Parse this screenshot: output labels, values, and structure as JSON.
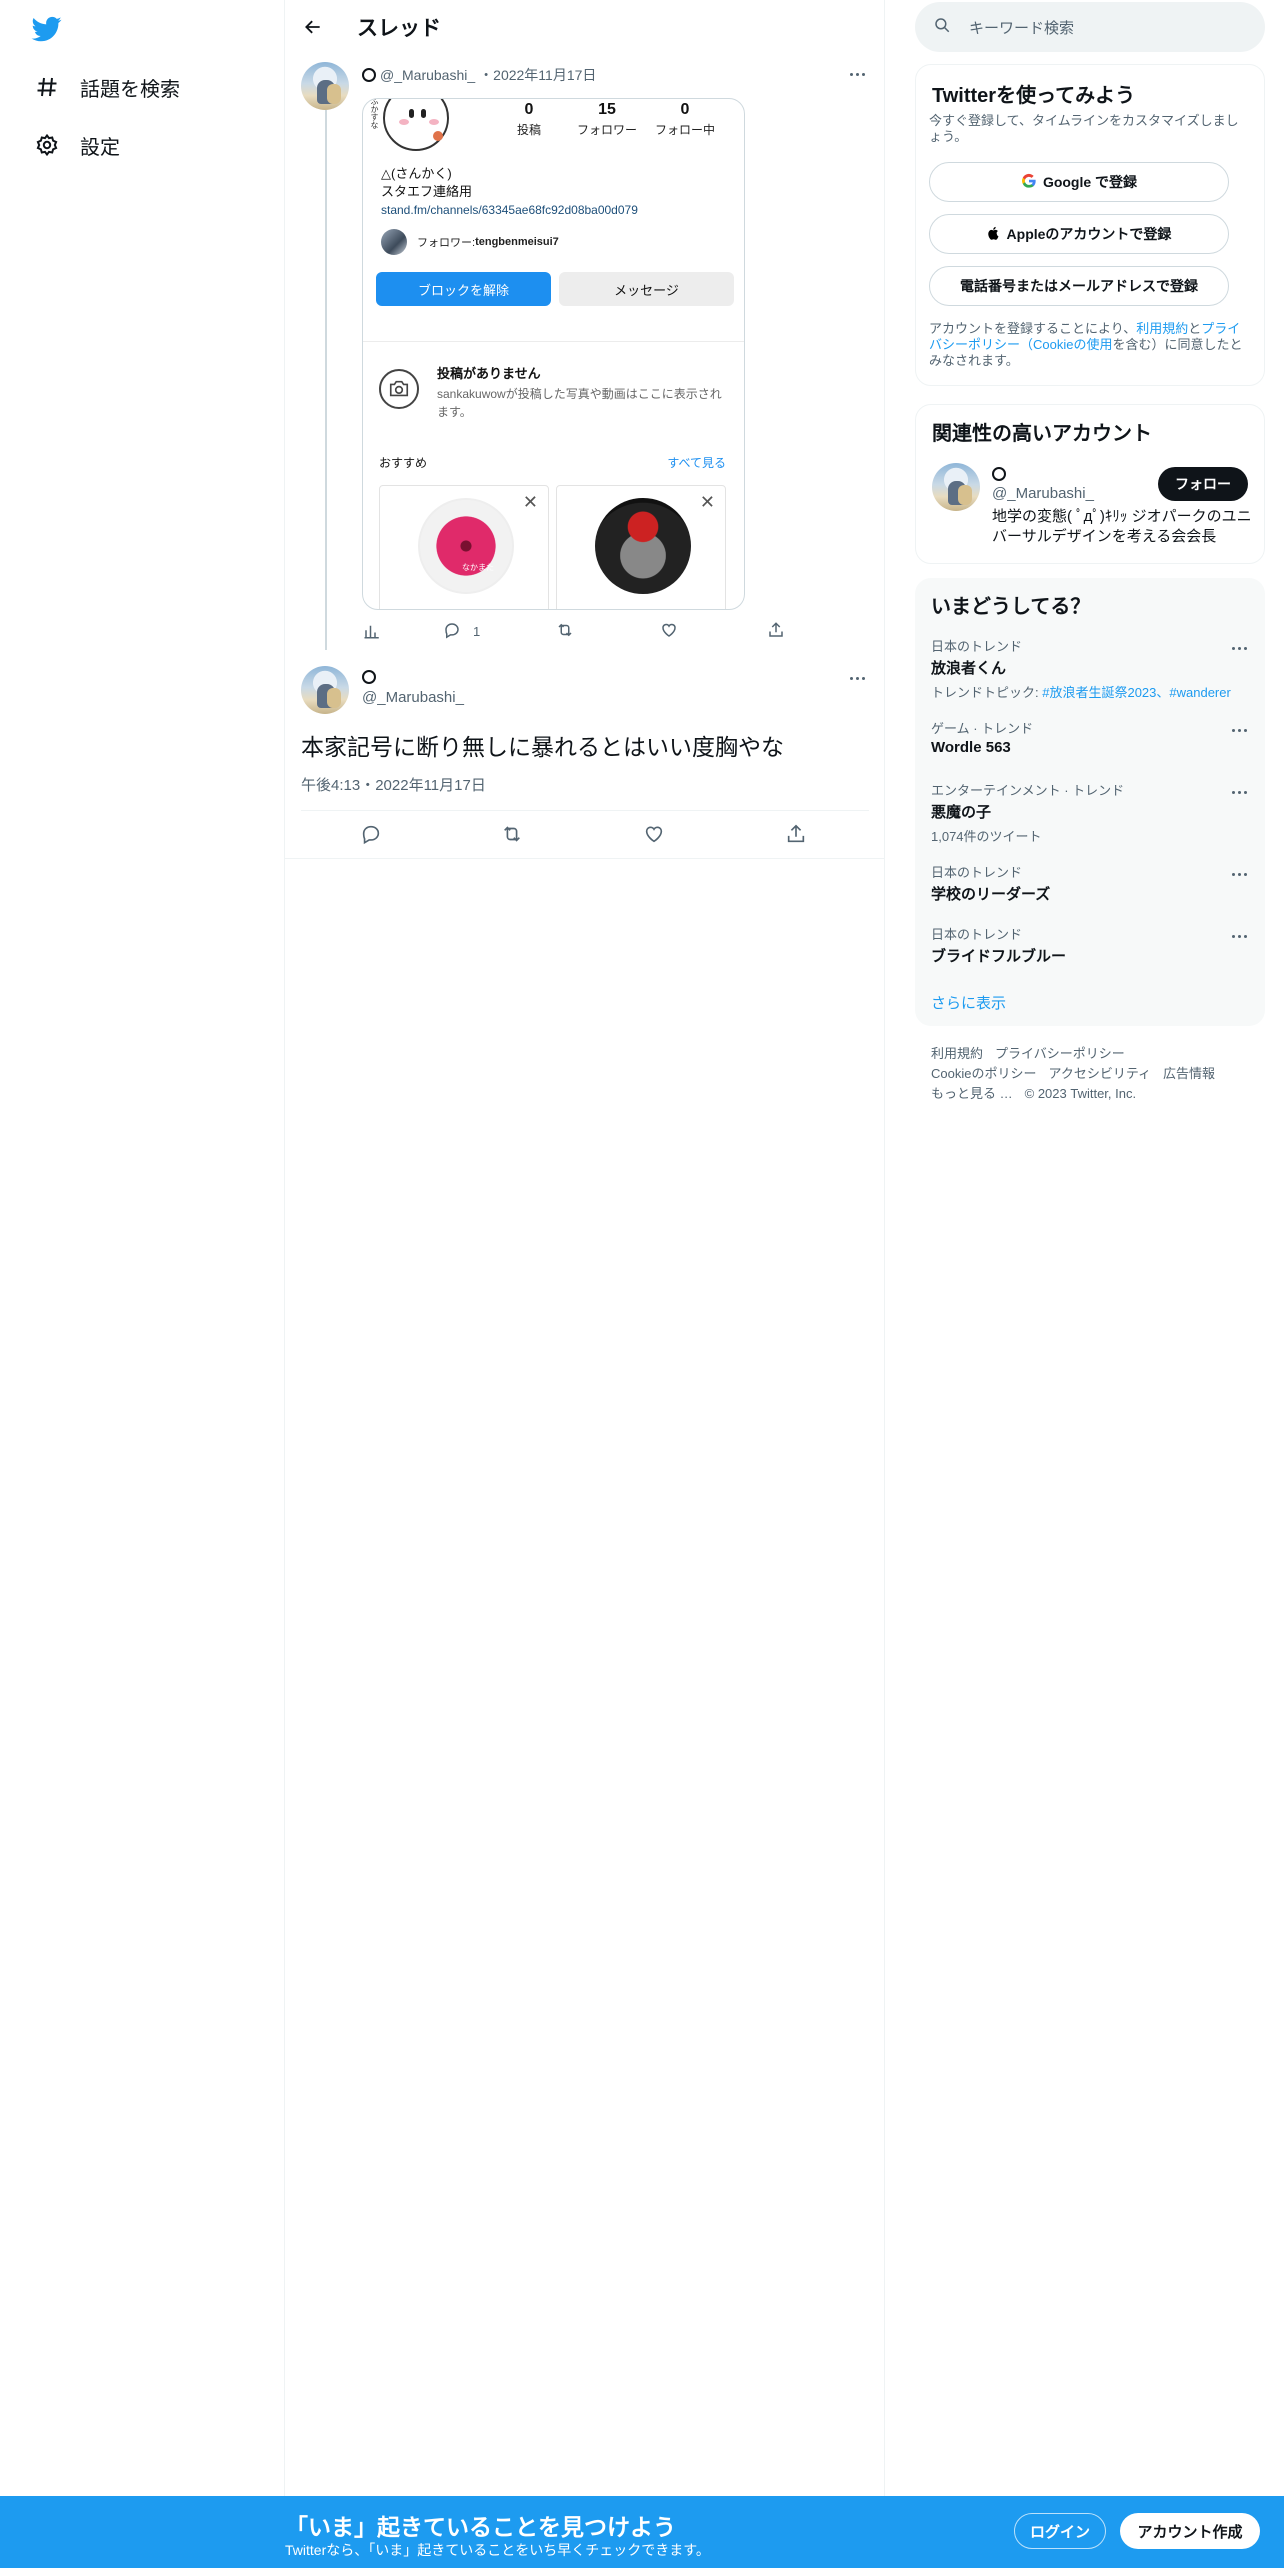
{
  "nav": {
    "items": [
      {
        "label": "話題を検索",
        "icon": "hashtag-icon"
      },
      {
        "label": "設定",
        "icon": "gear-icon"
      }
    ]
  },
  "header": {
    "title": "スレッド"
  },
  "first_tweet": {
    "handle": "@_Marubashi_",
    "date": "・2022年11月17日",
    "screenshot": {
      "stats": [
        {
          "num": "0",
          "label": "投稿"
        },
        {
          "num": "15",
          "label": "フォロワー"
        },
        {
          "num": "0",
          "label": "フォロー中"
        }
      ],
      "mascot_text": "ふかすな",
      "bio_name": "△(さんかく)",
      "bio_line": "スタエフ連絡用",
      "bio_link": "stand.fm/channels/63345ae68fc92d08ba00d079",
      "follower_prefix": "フォロワー: ",
      "follower_name": "tengbenmeisui7",
      "unblock_label": "ブロックを解除",
      "message_label": "メッセージ",
      "no_posts_title": "投稿がありません",
      "no_posts_desc": "sankakuwowが投稿した写真や動画はここに表示されます。",
      "recommend_label": "おすすめ",
      "see_all_label": "すべて見る",
      "flower_caption": "なかまた"
    },
    "reply_count": "1"
  },
  "main_tweet": {
    "handle": "@_Marubashi_",
    "text": "本家記号に断り無しに暴れるとはいい度胸やな",
    "time": "午後4:13・2022年11月17日"
  },
  "right": {
    "search_placeholder": "キーワード検索",
    "signup": {
      "title": "Twitterを使ってみよう",
      "subtitle": "今すぐ登録して、タイムラインをカスタマイズしましょう。",
      "google_label": "Google で登録",
      "apple_label": "Appleのアカウントで登録",
      "phone_label": "電話番号またはメールアドレスで登録",
      "terms_pre": "アカウントを登録することにより、",
      "terms_link1": "利用規約",
      "terms_mid": "と",
      "terms_link2": "プライバシーポリシー（Cookieの使用",
      "terms_post": "を含む）に同意したとみなされます。"
    },
    "related": {
      "title": "関連性の高いアカウント",
      "handle": "@_Marubashi_",
      "follow_label": "フォロー",
      "bio": "地学の変態( ﾟдﾟ)ｷﾘｯ ジオパークのユニバーサルデザインを考える会会長"
    },
    "trends": {
      "title": "いまどうしてる？",
      "items": [
        {
          "meta": "日本のトレンド",
          "name": "放浪者くん",
          "sub_pre": "トレンドトピック: ",
          "sub_hl": "#放浪者生誕祭2023、#wanderer"
        },
        {
          "meta": "ゲーム · トレンド",
          "name": "Wordle 563",
          "sub_pre": "",
          "sub_hl": ""
        },
        {
          "meta": "エンターテインメント · トレンド",
          "name": "悪魔の子",
          "sub_pre": "1,074件のツイート",
          "sub_hl": ""
        },
        {
          "meta": "日本のトレンド",
          "name": "学校のリーダーズ",
          "sub_pre": "",
          "sub_hl": ""
        },
        {
          "meta": "日本のトレンド",
          "name": "ブライドフルブルー",
          "sub_pre": "",
          "sub_hl": ""
        }
      ],
      "show_more": "さらに表示"
    },
    "footer": {
      "line1": [
        "利用規約",
        "プライバシーポリシー"
      ],
      "line2": [
        "Cookieのポリシー",
        "アクセシビリティ",
        "広告情報"
      ],
      "more": "もっと見る …",
      "copyright": "© 2023 Twitter, Inc."
    }
  },
  "bottom_bar": {
    "title": "「いま」起きていることを見つけよう",
    "subtitle": "Twitterなら、「いま」起きていることをいち早くチェックできます。",
    "login_label": "ログイン",
    "signup_label": "アカウント作成"
  },
  "colors": {
    "accent": "#1d9bf0",
    "text": "#0f1419",
    "muted": "#536471"
  }
}
